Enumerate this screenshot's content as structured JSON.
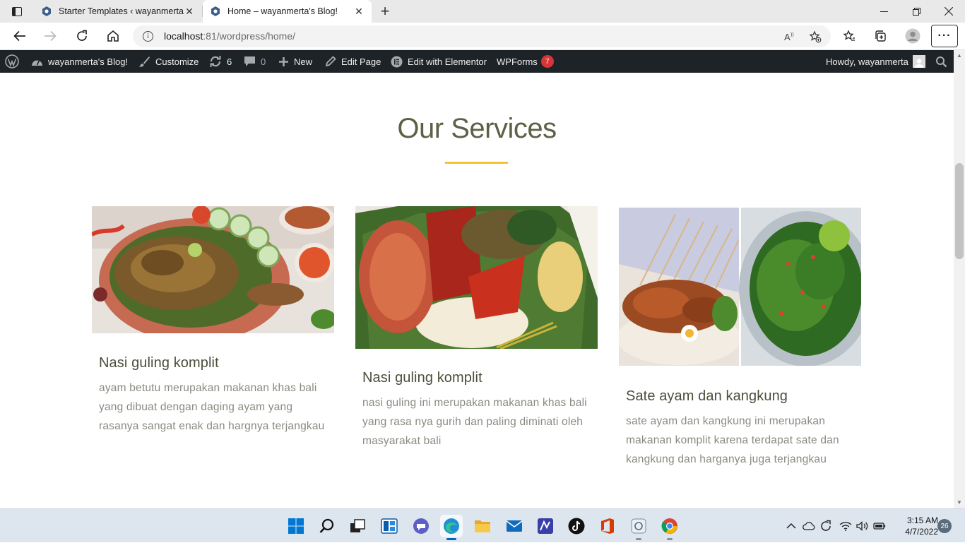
{
  "browser": {
    "tabs": [
      {
        "title": "Starter Templates ‹ wayanmerta’s Blog!"
      },
      {
        "title": "Home – wayanmerta's Blog!"
      }
    ],
    "url_host": "localhost",
    "url_path": ":81/wordpress/home/"
  },
  "wp_admin_bar": {
    "site_name": "wayanmerta's Blog!",
    "customize": "Customize",
    "updates_count": "6",
    "comments_count": "0",
    "new_label": "New",
    "edit_page": "Edit Page",
    "edit_elementor": "Edit with Elementor",
    "wpforms": "WPForms",
    "wpforms_badge": "7",
    "howdy": "Howdy, wayanmerta"
  },
  "section": {
    "title": "Our Services",
    "accent_color": "#f4c430",
    "cards": [
      {
        "title": "Nasi guling komplit",
        "description": "ayam betutu merupakan makanan khas bali yang dibuat dengan daging ayam yang rasanya sangat enak dan hargnya terjangkau",
        "image": "ayam betutu dish photo"
      },
      {
        "title": "Nasi guling komplit",
        "description": "nasi guling ini merupakan makanan khas bali yang rasa nya gurih dan paling diminati oleh masyarakat bali",
        "image": "nasi guling plate photo"
      },
      {
        "title": "Sate ayam dan kangkung",
        "description": "sate ayam dan kangkung ini merupakan makanan komplit karena terdapat sate dan kangkung dan harganya juga terjangkau",
        "image": "sate ayam and plecing kangkung photo"
      }
    ]
  },
  "taskbar": {
    "time": "3:15 AM",
    "date": "4/7/2022",
    "notifications": "26"
  }
}
